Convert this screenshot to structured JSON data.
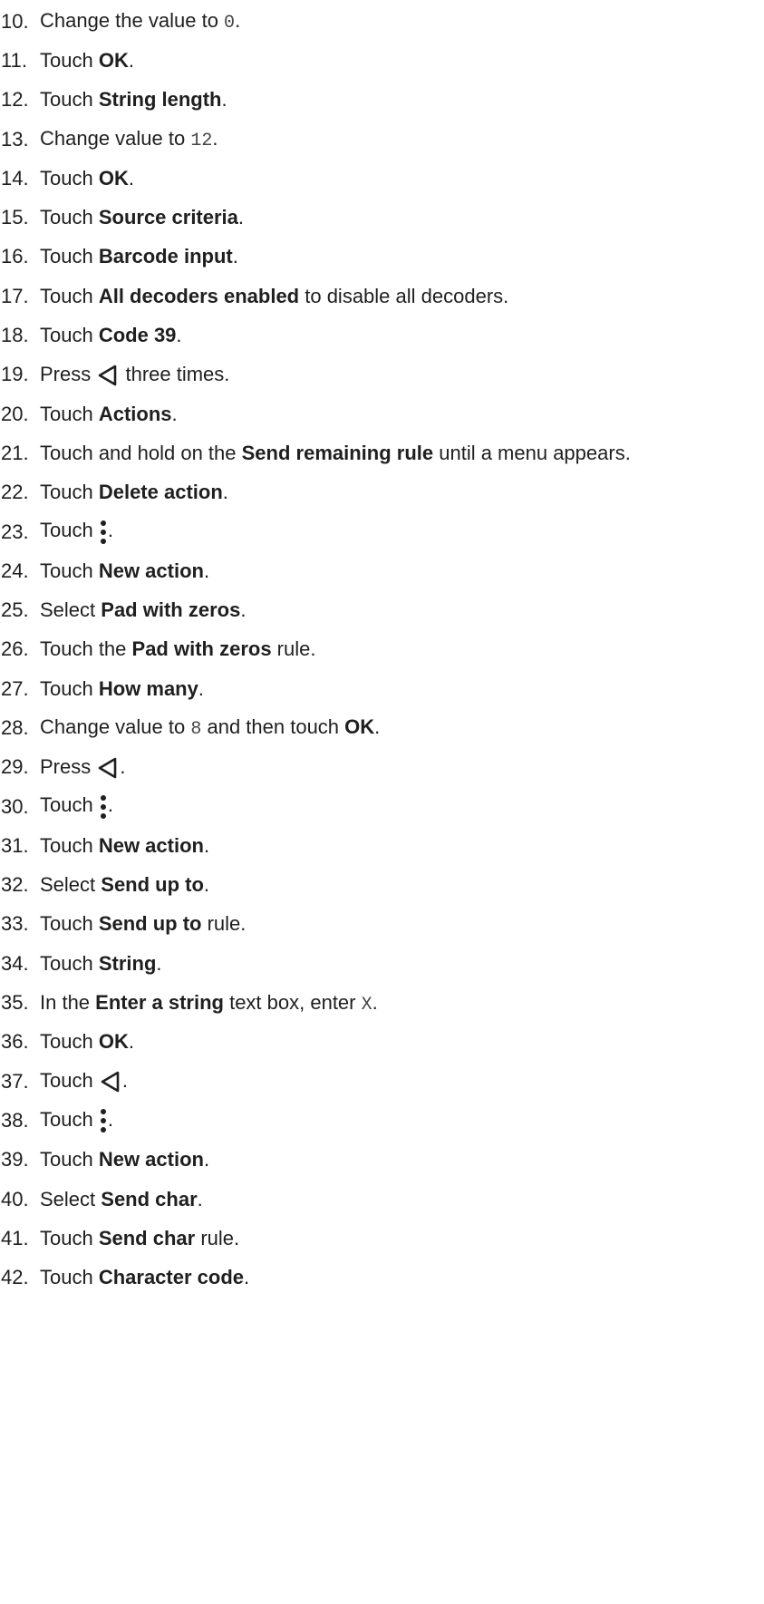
{
  "steps": [
    {
      "num": "10.",
      "parts": [
        {
          "t": "Change the value to "
        },
        {
          "code": "0"
        },
        {
          "t": "."
        }
      ]
    },
    {
      "num": "11.",
      "parts": [
        {
          "t": "Touch "
        },
        {
          "b": "OK"
        },
        {
          "t": "."
        }
      ]
    },
    {
      "num": "12.",
      "parts": [
        {
          "t": "Touch "
        },
        {
          "b": "String length"
        },
        {
          "t": "."
        }
      ]
    },
    {
      "num": "13.",
      "parts": [
        {
          "t": "Change value to "
        },
        {
          "code": "12"
        },
        {
          "t": "."
        }
      ]
    },
    {
      "num": "14.",
      "parts": [
        {
          "t": "Touch "
        },
        {
          "b": "OK"
        },
        {
          "t": "."
        }
      ]
    },
    {
      "num": "15.",
      "parts": [
        {
          "t": "Touch "
        },
        {
          "b": "Source criteria"
        },
        {
          "t": "."
        }
      ]
    },
    {
      "num": "16.",
      "parts": [
        {
          "t": "Touch "
        },
        {
          "b": "Barcode input"
        },
        {
          "t": "."
        }
      ]
    },
    {
      "num": "17.",
      "parts": [
        {
          "t": "Touch "
        },
        {
          "b": "All decoders enabled"
        },
        {
          "t": " to disable all decoders."
        }
      ]
    },
    {
      "num": "18.",
      "parts": [
        {
          "t": "Touch "
        },
        {
          "b": "Code 39"
        },
        {
          "t": "."
        }
      ]
    },
    {
      "num": "19.",
      "parts": [
        {
          "t": "Press "
        },
        {
          "icon": "back-icon"
        },
        {
          "t": " three times."
        }
      ]
    },
    {
      "num": "20.",
      "parts": [
        {
          "t": "Touch "
        },
        {
          "b": "Actions"
        },
        {
          "t": "."
        }
      ]
    },
    {
      "num": "21.",
      "parts": [
        {
          "t": "Touch and hold on the "
        },
        {
          "b": "Send remaining rule"
        },
        {
          "t": " until a menu appears."
        }
      ]
    },
    {
      "num": "22.",
      "parts": [
        {
          "t": "Touch "
        },
        {
          "b": "Delete action"
        },
        {
          "t": "."
        }
      ]
    },
    {
      "num": "23.",
      "parts": [
        {
          "t": "Touch "
        },
        {
          "icon": "more-vert-icon"
        },
        {
          "t": "."
        }
      ]
    },
    {
      "num": "24.",
      "parts": [
        {
          "t": "Touch "
        },
        {
          "b": "New action"
        },
        {
          "t": "."
        }
      ]
    },
    {
      "num": "25.",
      "parts": [
        {
          "t": "Select "
        },
        {
          "b": "Pad with zeros"
        },
        {
          "t": "."
        }
      ]
    },
    {
      "num": "26.",
      "parts": [
        {
          "t": "Touch the "
        },
        {
          "b": "Pad with zeros"
        },
        {
          "t": " rule."
        }
      ]
    },
    {
      "num": "27.",
      "parts": [
        {
          "t": "Touch "
        },
        {
          "b": "How many"
        },
        {
          "t": "."
        }
      ]
    },
    {
      "num": "28.",
      "parts": [
        {
          "t": "Change value to "
        },
        {
          "code": "8"
        },
        {
          "t": " and then touch "
        },
        {
          "b": "OK"
        },
        {
          "t": "."
        }
      ]
    },
    {
      "num": "29.",
      "parts": [
        {
          "t": "Press "
        },
        {
          "icon": "back-icon"
        },
        {
          "t": "."
        }
      ]
    },
    {
      "num": "30.",
      "parts": [
        {
          "t": "Touch "
        },
        {
          "icon": "more-vert-icon"
        },
        {
          "t": "."
        }
      ]
    },
    {
      "num": "31.",
      "parts": [
        {
          "t": "Touch "
        },
        {
          "b": "New action"
        },
        {
          "t": "."
        }
      ]
    },
    {
      "num": "32.",
      "parts": [
        {
          "t": "Select "
        },
        {
          "b": "Send up to"
        },
        {
          "t": "."
        }
      ]
    },
    {
      "num": "33.",
      "parts": [
        {
          "t": "Touch "
        },
        {
          "b": "Send up to"
        },
        {
          "t": " rule."
        }
      ]
    },
    {
      "num": "34.",
      "parts": [
        {
          "t": "Touch "
        },
        {
          "b": "String"
        },
        {
          "t": "."
        }
      ]
    },
    {
      "num": "35.",
      "parts": [
        {
          "t": "In the "
        },
        {
          "b": "Enter a string"
        },
        {
          "t": " text box, enter "
        },
        {
          "code": "X"
        },
        {
          "t": "."
        }
      ]
    },
    {
      "num": "36.",
      "parts": [
        {
          "t": "Touch "
        },
        {
          "b": "OK"
        },
        {
          "t": "."
        }
      ]
    },
    {
      "num": "37.",
      "parts": [
        {
          "t": "Touch "
        },
        {
          "icon": "back-icon"
        },
        {
          "t": "."
        }
      ]
    },
    {
      "num": "38.",
      "parts": [
        {
          "t": "Touch "
        },
        {
          "icon": "more-vert-icon"
        },
        {
          "t": "."
        }
      ]
    },
    {
      "num": "39.",
      "parts": [
        {
          "t": "Touch "
        },
        {
          "b": "New action"
        },
        {
          "t": "."
        }
      ]
    },
    {
      "num": "40.",
      "parts": [
        {
          "t": "Select "
        },
        {
          "b": "Send char"
        },
        {
          "t": "."
        }
      ]
    },
    {
      "num": "41.",
      "parts": [
        {
          "t": "Touch "
        },
        {
          "b": "Send char"
        },
        {
          "t": " rule."
        }
      ]
    },
    {
      "num": "42.",
      "parts": [
        {
          "t": "Touch "
        },
        {
          "b": "Character code"
        },
        {
          "t": "."
        }
      ]
    }
  ]
}
